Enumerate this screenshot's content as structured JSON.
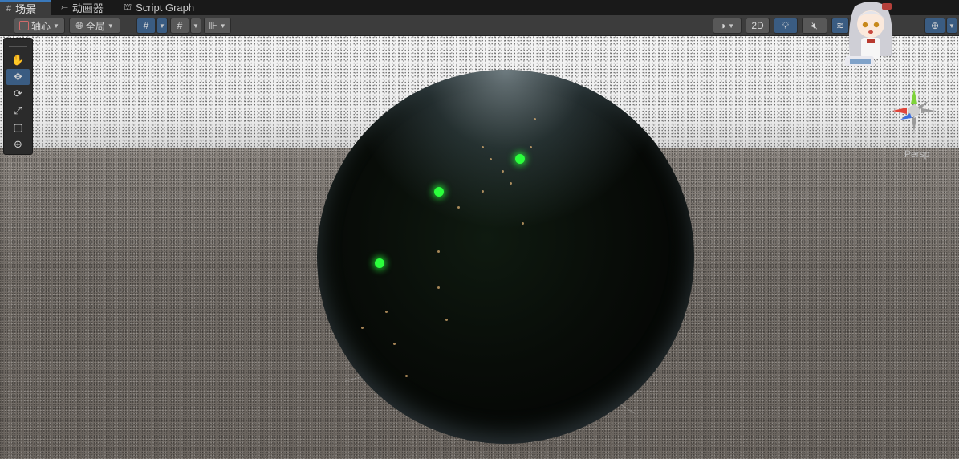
{
  "tabs": [
    {
      "icon": "grid-icon",
      "label": "场景",
      "active": true
    },
    {
      "icon": "animator-icon",
      "label": "动画器",
      "active": false
    },
    {
      "icon": "graph-icon",
      "label": "Script Graph",
      "active": false
    }
  ],
  "toolbar": {
    "pivot_label": "轴心",
    "global_label": "全局",
    "mode_2d_label": "2D"
  },
  "tools": [
    {
      "name": "hand-tool",
      "icon": "✋",
      "active": false
    },
    {
      "name": "move-tool",
      "icon": "✥",
      "active": true
    },
    {
      "name": "rotate-tool",
      "icon": "⟳",
      "active": false
    },
    {
      "name": "scale-tool",
      "icon": "⤢",
      "active": false
    },
    {
      "name": "rect-tool",
      "icon": "▢",
      "active": false
    },
    {
      "name": "transform-tool",
      "icon": "⊕",
      "active": false
    }
  ],
  "viewport": {
    "projection_label": "Persp"
  },
  "colors": {
    "accent": "#3a79bb",
    "marker": "#2bff3c",
    "toolbar_bg": "#3c3c3c"
  }
}
